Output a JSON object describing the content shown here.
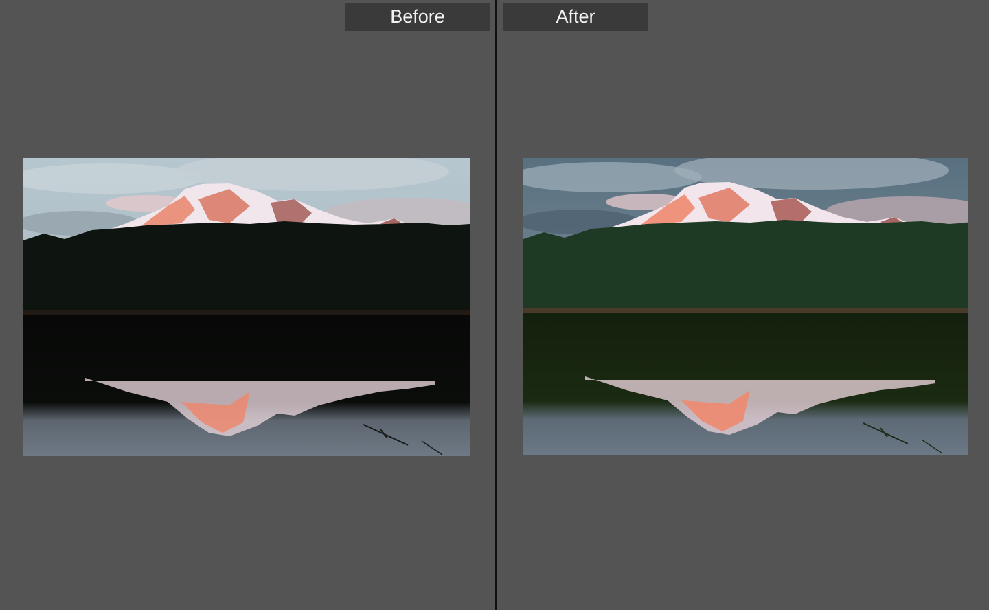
{
  "comparison": {
    "before": {
      "label": "Before",
      "image_subject": "mountain-lake-reflection",
      "colors": {
        "sky_top": "#b8c8cf",
        "sky_bottom": "#9aa9b2",
        "cloud": "#c9d3d8",
        "forest": "#0e140f",
        "water_dark": "#0a0c09",
        "water_reflect": "#6b7681",
        "snow": "#f2e9ee",
        "alpenglow": "#e98a72",
        "rock": "#8a5a55"
      }
    },
    "after": {
      "label": "After",
      "image_subject": "mountain-lake-reflection",
      "colors": {
        "sky_top": "#5c7380",
        "sky_bottom": "#8e9aa4",
        "cloud": "#a9b6be",
        "forest": "#1f3a24",
        "water_dark": "#18230f",
        "water_reflect": "#6a7784",
        "snow": "#f5e6ec",
        "alpenglow": "#ee8a70",
        "rock": "#9a5a55"
      }
    }
  }
}
